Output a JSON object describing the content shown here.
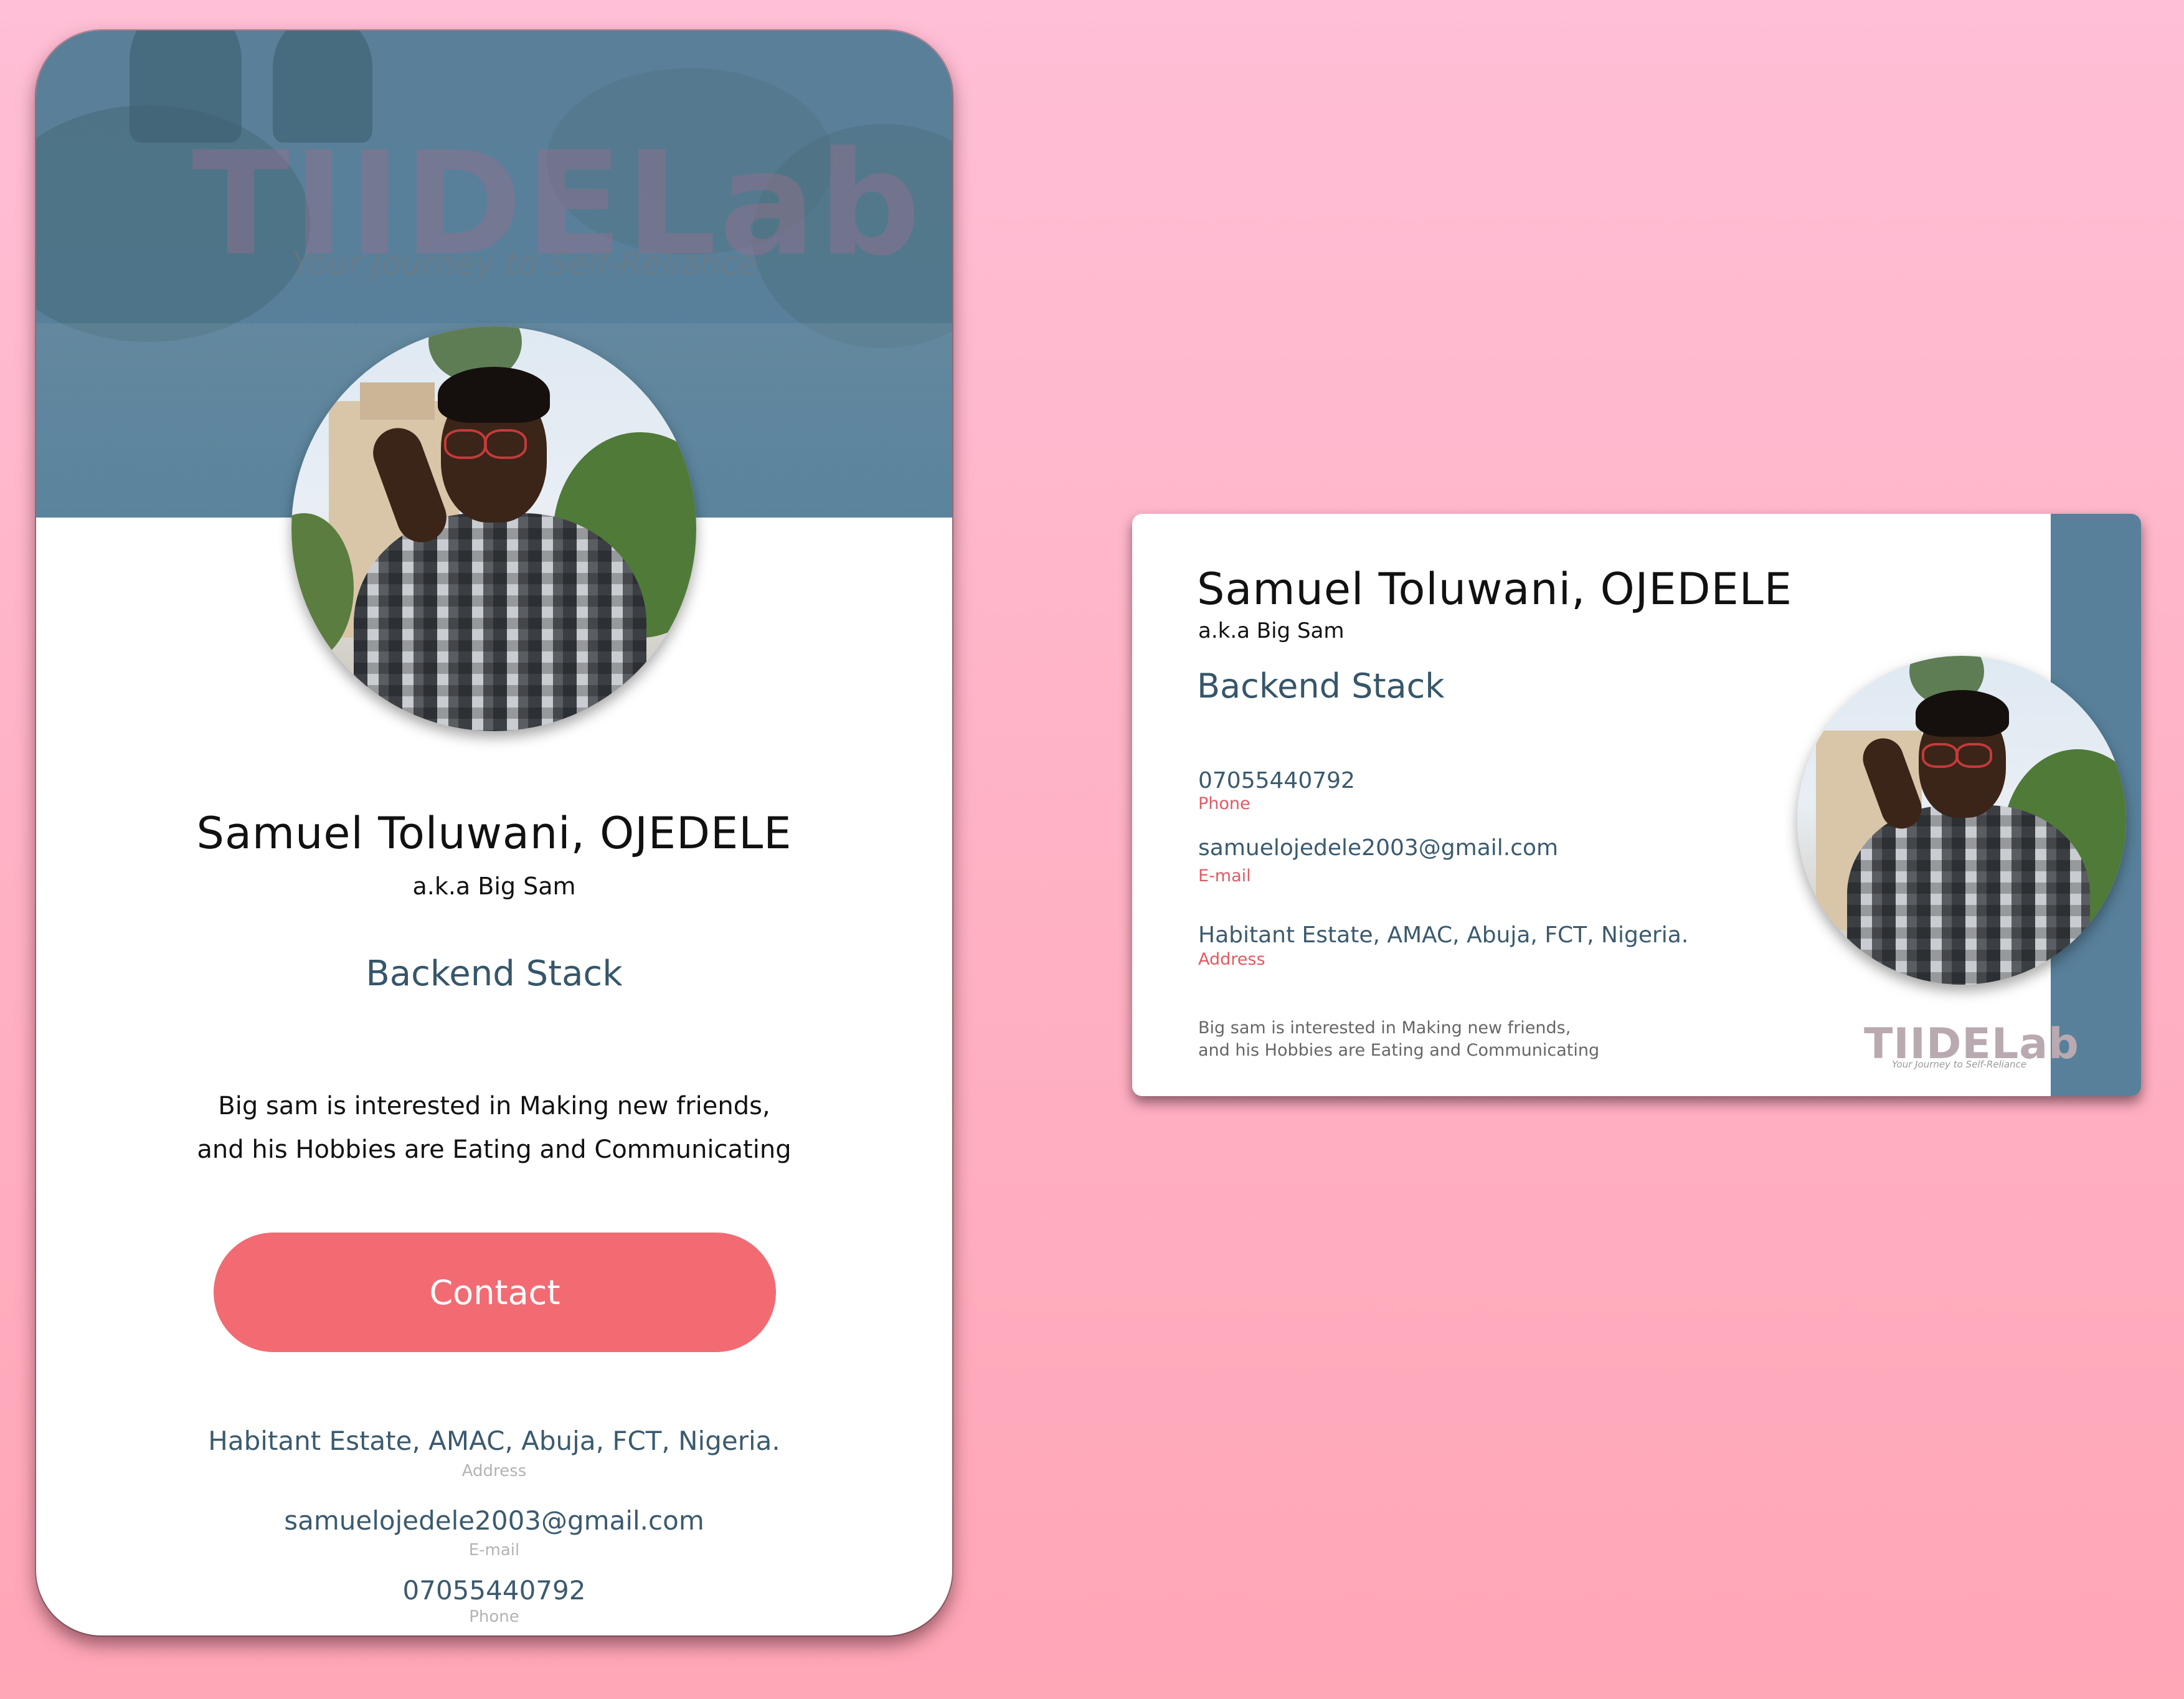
{
  "colors": {
    "background_top": "#ffbfd6",
    "background_bottom": "#ffa6b7",
    "banner": "#58809b",
    "accent_red": "#f26b73",
    "role_blue": "#36566a",
    "info_blue": "#3b5a6e"
  },
  "logo": {
    "text": "TIIDELab",
    "tagline": "Your Journey to Self-Reliance"
  },
  "profile": {
    "name": "Samuel  Toluwani, OJEDELE",
    "aka": "a.k.a Big Sam",
    "role": "Backend Stack",
    "bio_line1": "Big sam is interested in Making new friends,",
    "bio_line2": "and his Hobbies are Eating and Communicating",
    "phone": "07055440792",
    "phone_label": "Phone",
    "email": "samuelojedele2003@gmail.com",
    "email_label": "E-mail",
    "address": "Habitant Estate, AMAC, Abuja, FCT, Nigeria.",
    "address_label": "Address"
  },
  "vertical_card": {
    "contact_label": "Contact"
  },
  "icons": {
    "avatar": "person-photo",
    "banner": "tiidelab-banner-image"
  }
}
